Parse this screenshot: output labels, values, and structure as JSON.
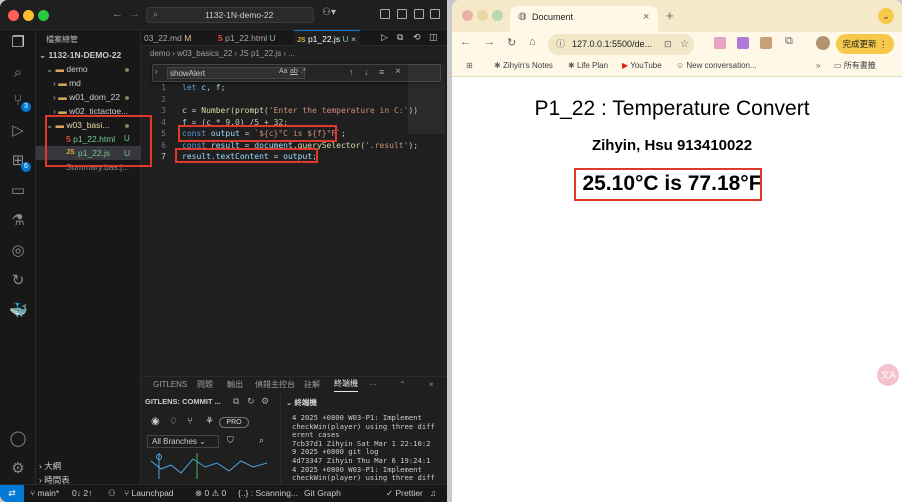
{
  "vscode": {
    "window_search": "1132-1N-demo-22",
    "explorer_title": "檔案總管",
    "project_root": "1132-1N-DEMO-22",
    "tree": [
      {
        "label": "demo",
        "kind": "folder-open",
        "indent": 1
      },
      {
        "label": "md",
        "kind": "folder",
        "indent": 2
      },
      {
        "label": "w01_dom_22",
        "kind": "folder",
        "indent": 2
      },
      {
        "label": "w02_tictactoe...",
        "kind": "folder",
        "indent": 2
      },
      {
        "label": "w03_basi...",
        "kind": "folder-open",
        "indent": 2
      },
      {
        "label": "p1_22.html",
        "kind": "html",
        "status": "U",
        "indent": 3
      },
      {
        "label": "p1_22.js",
        "kind": "js",
        "status": "U",
        "indent": 3
      },
      {
        "label": "Summary.bas.j...",
        "kind": "file",
        "indent": 2
      }
    ],
    "outline_label": "大綱",
    "timeline_label": "時間表",
    "tabs": [
      {
        "label": "03_22.md",
        "status": "M",
        "icon": "markdown-icon"
      },
      {
        "label": "p1_22.html",
        "status": "U",
        "icon": "html5-icon"
      },
      {
        "label": "p1_22.js",
        "status": "U",
        "icon": "js-icon",
        "active": true
      }
    ],
    "breadcrumb": [
      "demo",
      "w03_basics_22",
      "JS p1_22.js",
      "..."
    ],
    "find_query": "showAlert",
    "find_options": [
      "Aa",
      "ab",
      ".*"
    ],
    "code_lines": [
      {
        "n": "1",
        "text": "let c, f;"
      },
      {
        "n": "2",
        "text": ""
      },
      {
        "n": "3",
        "text": "c = Number(prompt('Enter the temperature in C:'))"
      },
      {
        "n": "4",
        "text": "f = (c * 9.0) /5 + 32;"
      },
      {
        "n": "5",
        "text": "const output = `${c}°C is ${f}°F`;"
      },
      {
        "n": "6",
        "text": "const result = document.querySelector('.result');"
      },
      {
        "n": "7",
        "text": "result.textContent = output;"
      }
    ],
    "panel_tabs": [
      "GITLENS",
      "問題",
      "輸出",
      "偵錯主控台",
      "註解",
      "終端機"
    ],
    "panel_active_tab": "終端機",
    "gitlens_header": "GITLENS: COMMIT ...",
    "terminal_header": "終端機",
    "branches_label": "All Branches",
    "pro_label": "PRO",
    "terminal_lines": [
      "4 2025 +0800   W03-P1: Implement",
      "checkWin(player) using three diff",
      "erent cases",
      "7cb37d1 Zihyin  Sat Mar 1 22:10:2",
      "9 2025 +0800   git log",
      "4d73347 Zihyin  Thu Mar 6 19:24:1",
      "4 2025 +0800   W03-P1: Implement",
      "checkWin(player) using three diff"
    ],
    "status": {
      "branch": "main*",
      "sync": "0↓ 2↑",
      "launchpad": "Launchpad",
      "problems": "⊗ 0 ⚠ 0",
      "scanning": "{..} : Scanning...",
      "git_graph": "Git Graph",
      "prettier": "✓ Prettier"
    },
    "badges": {
      "source_control": "3",
      "extensions": "6"
    }
  },
  "chrome": {
    "tab_title": "Document",
    "url": "127.0.0.1:5500/de...",
    "update_button": "完成更新",
    "bookmarks": [
      {
        "label": "Zihyin's Notes",
        "icon": "star-icon"
      },
      {
        "label": "Life Plan",
        "icon": "star-icon"
      },
      {
        "label": "YouTube",
        "icon": "youtube-icon"
      },
      {
        "label": "New conversation...",
        "icon": "bot-icon"
      }
    ],
    "all_bookmarks": "所有書籤",
    "page": {
      "heading": "P1_22 : Temperature Convert",
      "author": "Zihyin, Hsu 913410022",
      "result": "25.10°C is 77.18°F"
    }
  },
  "colors": {
    "accent_red_box": "#e0382b",
    "vscode_bg": "#1f1f1f",
    "chrome_tabstrip": "#f5e9c9",
    "update_button_bg": "#f6c94a"
  }
}
